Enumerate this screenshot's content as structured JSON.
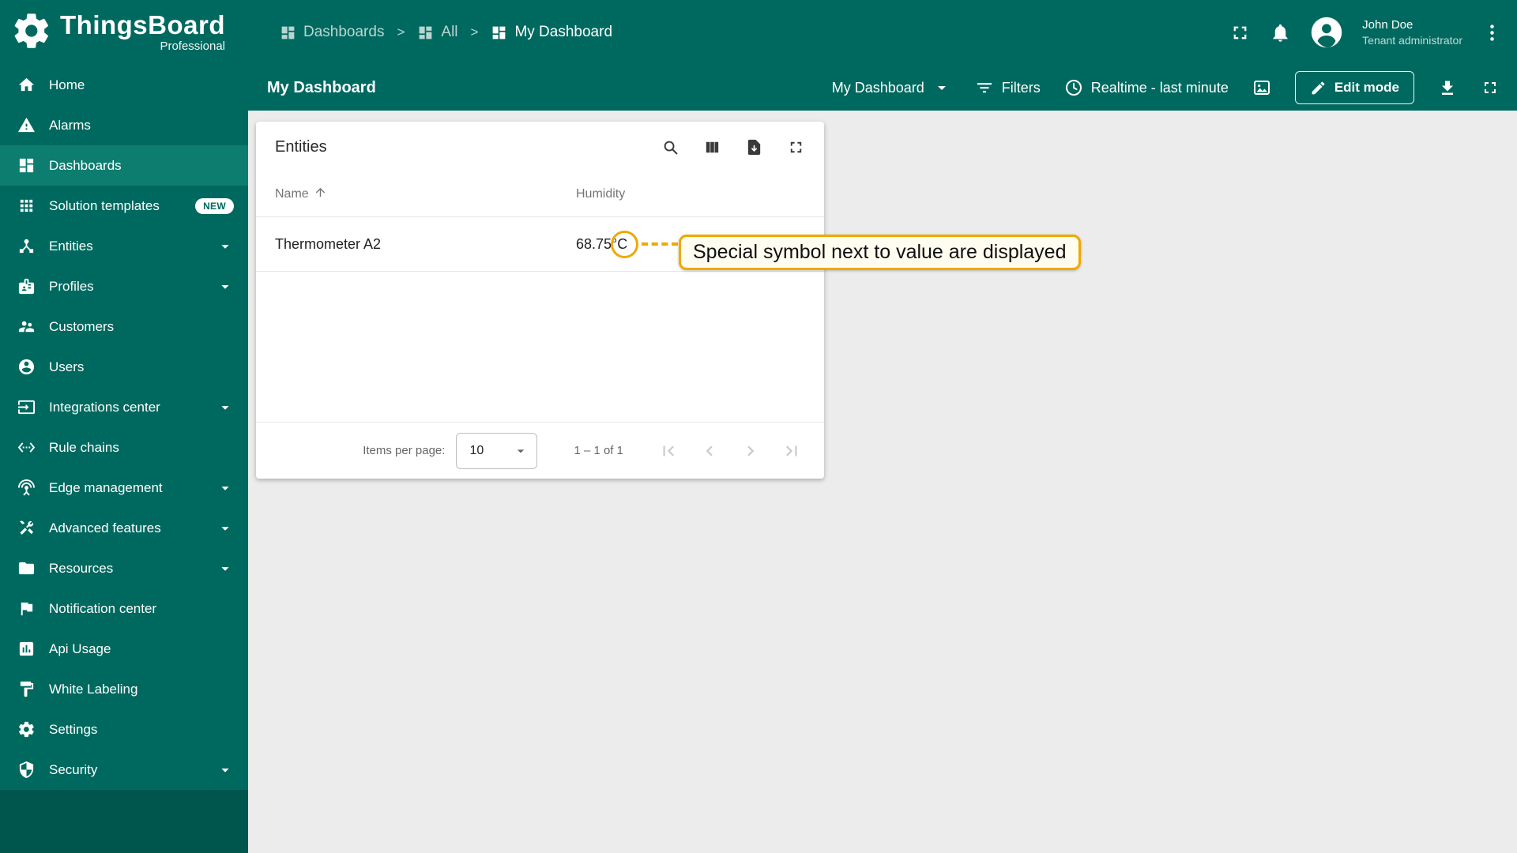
{
  "header": {
    "logo_title": "ThingsBoard",
    "logo_subtitle": "Professional",
    "separator": ">",
    "breadcrumbs": [
      {
        "label": "Dashboards"
      },
      {
        "label": "All"
      },
      {
        "label": "My Dashboard"
      }
    ],
    "user": {
      "name": "John Doe",
      "role": "Tenant administrator"
    }
  },
  "sidebar": {
    "items": [
      {
        "label": "Home"
      },
      {
        "label": "Alarms"
      },
      {
        "label": "Dashboards",
        "active": true
      },
      {
        "label": "Solution templates",
        "badge": "NEW"
      },
      {
        "label": "Entities",
        "expandable": true
      },
      {
        "label": "Profiles",
        "expandable": true
      },
      {
        "label": "Customers"
      },
      {
        "label": "Users"
      },
      {
        "label": "Integrations center",
        "expandable": true
      },
      {
        "label": "Rule chains"
      },
      {
        "label": "Edge management",
        "expandable": true
      },
      {
        "label": "Advanced features",
        "expandable": true
      },
      {
        "label": "Resources",
        "expandable": true
      },
      {
        "label": "Notification center"
      },
      {
        "label": "Api Usage"
      },
      {
        "label": "White Labeling"
      },
      {
        "label": "Settings"
      },
      {
        "label": "Security",
        "expandable": true
      }
    ]
  },
  "toolbar": {
    "title": "My Dashboard",
    "state_selector_label": "My Dashboard",
    "filters_label": "Filters",
    "timewindow_label": "Realtime - last minute",
    "edit_mode_label": "Edit mode"
  },
  "widget": {
    "title": "Entities",
    "columns": {
      "name": "Name",
      "humidity": "Humidity"
    },
    "rows": [
      {
        "name": "Thermometer A2",
        "humidity_value": "68.75",
        "humidity_unit": "°C"
      }
    ],
    "pagination": {
      "items_per_page_label": "Items per page:",
      "items_per_page_value": "10",
      "range_label": "1 – 1 of 1"
    }
  },
  "annotation": {
    "text": "Special symbol next to value are displayed"
  },
  "colors": {
    "primary": "#00695f",
    "primary_dark": "#00564d",
    "active_item": "#0d7d70",
    "annotation_accent": "#efa900",
    "content_bg": "#ececec"
  }
}
